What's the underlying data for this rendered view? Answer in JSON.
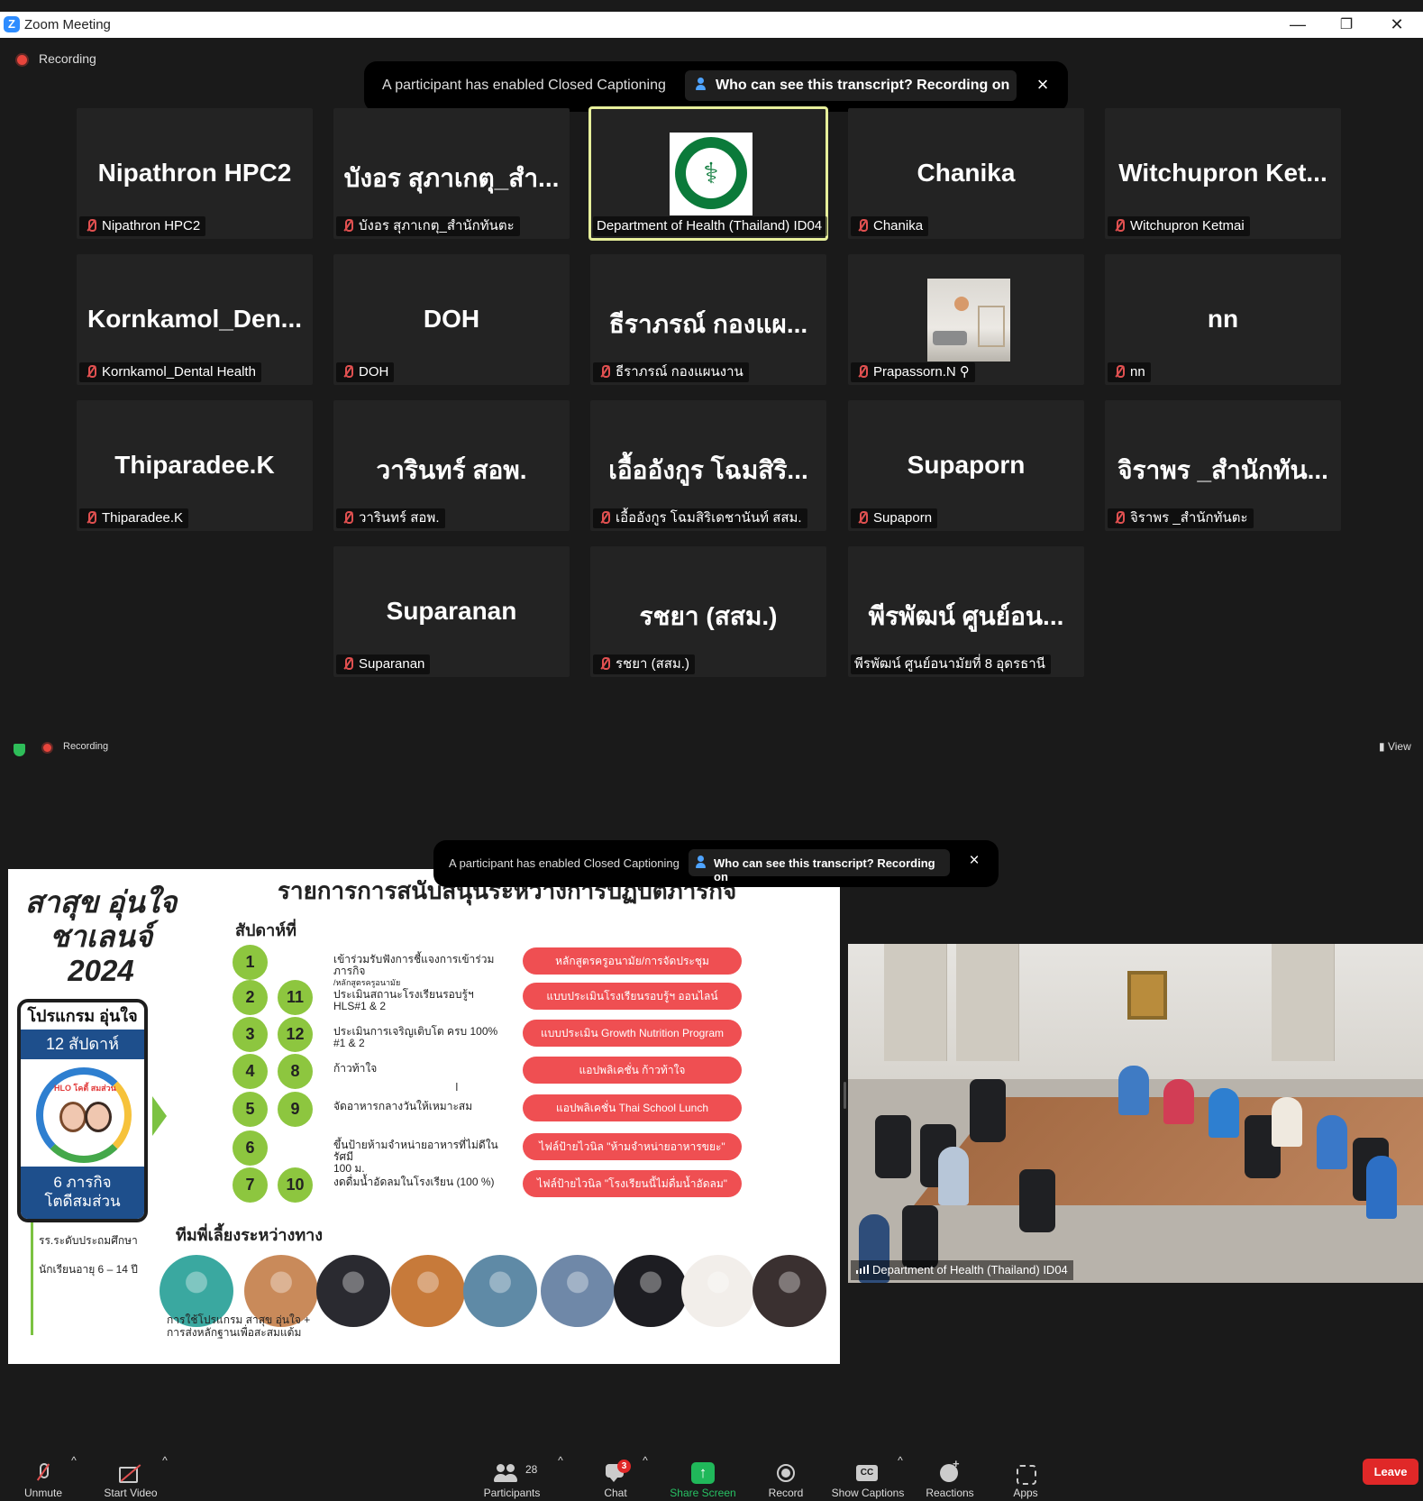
{
  "window": {
    "title": "Zoom Meeting",
    "minimize_glyph": "—",
    "restore_glyph": "❐",
    "close_glyph": "✕"
  },
  "top": {
    "recording_label": "Recording",
    "banner": {
      "message": "A participant has enabled Closed Captioning",
      "button": "Who can see this transcript? Recording on",
      "close": "×"
    },
    "tiles": [
      {
        "big": "Nipathron HPC2",
        "tag": "Nipathron HPC2",
        "muted": true
      },
      {
        "big": "บังอร สุภาเกตุ_สำ...",
        "tag": "บังอร สุภาเกตุ_สำนักทันตะ",
        "muted": true
      },
      {
        "big": "",
        "tag": "Department of Health (Thailand) ID04",
        "muted": false,
        "active": true,
        "avatar": "ministry-of-public-health-logo"
      },
      {
        "big": "Chanika",
        "tag": "Chanika",
        "muted": true
      },
      {
        "big": "Witchupron Ket...",
        "tag": "Witchupron Ketmai",
        "muted": true
      },
      {
        "big": "Kornkamol_Den...",
        "tag": "Kornkamol_Dental Health",
        "muted": true
      },
      {
        "big": "DOH",
        "tag": "DOH",
        "muted": true
      },
      {
        "big": "ธีราภรณ์ กองแผ...",
        "tag": "ธีราภรณ์ กองแผนงาน",
        "muted": true
      },
      {
        "big": "",
        "tag": "Prapassorn.N ⚲",
        "muted": true,
        "avatar": "room-photo"
      },
      {
        "big": "nn",
        "tag": "nn",
        "muted": true
      },
      {
        "big": "Thiparadee.K",
        "tag": "Thiparadee.K",
        "muted": true
      },
      {
        "big": "วารินทร์ สอพ.",
        "tag": "วารินทร์ สอพ.",
        "muted": true
      },
      {
        "big": "เอื้ออังกูร โฉมสิริ...",
        "tag": "เอื้ออังกูร โฉมสิริเดชานันท์ สสม.",
        "muted": true
      },
      {
        "big": "Supaporn",
        "tag": "Supaporn",
        "muted": true
      },
      {
        "big": "จิราพร _สำนักทัน...",
        "tag": "จิราพร _สำนักทันตะ",
        "muted": true
      },
      {
        "big": "Suparanan",
        "tag": "Suparanan",
        "muted": true
      },
      {
        "big": "รชยา (สสม.)",
        "tag": "รชยา (สสม.)",
        "muted": true
      },
      {
        "big": "พีรพัฒน์ ศูนย์อน...",
        "tag": "พีรพัฒน์ ศูนย์อนามัยที่ 8 อุดรธานี",
        "muted": false
      }
    ]
  },
  "bottom": {
    "recording_label": "Recording",
    "view_label": "View",
    "banner": {
      "message": "A participant has enabled Closed Captioning",
      "button": "Who can see this transcript? Recording on",
      "close": "×"
    },
    "slide": {
      "title": "รายการการสนับสนุนระหว่างการปฏิบัติภารกิจ",
      "brand_lines": [
        "สาสุข อุ่นใจ",
        "ชาเลนจ์",
        "2024"
      ],
      "program_title": "โปรแกรม อุ่นใจ",
      "program_weeks": "12 สัปดาห์",
      "program_logo_text": "HLO โคตี้ สมส่วน",
      "program_footer_1": "6 ภารกิจ",
      "program_footer_2": "โตดีสมส่วน",
      "note_1": "รร.ระดับประถมศึกษา",
      "note_2": "นักเรียนอายุ 6 – 14 ปี",
      "week_label": "สัปดาห์ที่",
      "rows": [
        {
          "n1": "1",
          "n2": "",
          "activity": "เข้าร่วมรับฟังการชี้แจงการเข้าร่วมภารกิจ",
          "activity_sub": "/หลักสูตรครูอนามัย",
          "pill": "หลักสูตรครูอนามัย/การจัดประชุม"
        },
        {
          "n1": "2",
          "n2": "11",
          "activity": "ประเมินสถานะโรงเรียนรอบรู้ฯ",
          "activity_sub": "HLS#1 & 2",
          "pill": "แบบประเมินโรงเรียนรอบรู้ฯ ออนไลน์"
        },
        {
          "n1": "3",
          "n2": "12",
          "activity": "ประเมินการเจริญเติบโต ครบ 100%",
          "activity_sub": "#1 & 2",
          "pill": "แบบประเมิน Growth Nutrition Program"
        },
        {
          "n1": "4",
          "n2": "8",
          "activity": "ก้าวท้าใจ",
          "activity_sub": "",
          "pill": "แอปพลิเคชั่น ก้าวท้าใจ"
        },
        {
          "n1": "5",
          "n2": "9",
          "activity": "จัดอาหารกลางวันให้เหมาะสม",
          "activity_sub": "",
          "pill": "แอปพลิเคชั่น Thai School Lunch"
        },
        {
          "n1": "6",
          "n2": "",
          "activity": "ขึ้นป้ายห้ามจำหน่ายอาหารที่ไม่ดีในรัศมี",
          "activity_sub": "100 ม.",
          "pill": "ไฟล์ป้ายไวนิล \"ห้ามจำหน่ายอาหารขยะ\""
        },
        {
          "n1": "7",
          "n2": "10",
          "activity": "งดดื่มน้ำอัดลมในโรงเรียน (100 %)",
          "activity_sub": "",
          "pill": "ไฟล์ป้ายไวนิล \"โรงเรียนนี้ไม่ดื่มน้ำอัดลม\""
        }
      ],
      "team_label": "ทีมพี่เลี้ยงระหว่างทาง",
      "caption_1": "การใช้โปรแกรม สาสุข อุ่นใจ +",
      "caption_2": "การส่งหลักฐานเพื่อสะสมแต้ม",
      "avatar_colors": [
        "#3aa8a0",
        "#c98a5a",
        "#2a2a30",
        "#c77a3a",
        "#5f8aa6",
        "#6f88a8",
        "#1d1d22",
        "#f2eeea",
        "#3a3030"
      ]
    },
    "camera_label": "Department of Health (Thailand) ID04"
  },
  "toolbar": {
    "unmute": "Unmute",
    "start_video": "Start Video",
    "participants": "Participants",
    "participants_count": "28",
    "chat": "Chat",
    "chat_badge": "3",
    "share_screen": "Share Screen",
    "record": "Record",
    "show_captions": "Show Captions",
    "reactions": "Reactions",
    "apps": "Apps",
    "leave": "Leave"
  },
  "colors": {
    "accent": "#2d8cff",
    "active_speaker": "#e7ef9b",
    "share_green": "#20b85a",
    "leave_red": "#e02828",
    "slide_pill": "#ef4f52",
    "slide_num": "#8dc63f"
  }
}
